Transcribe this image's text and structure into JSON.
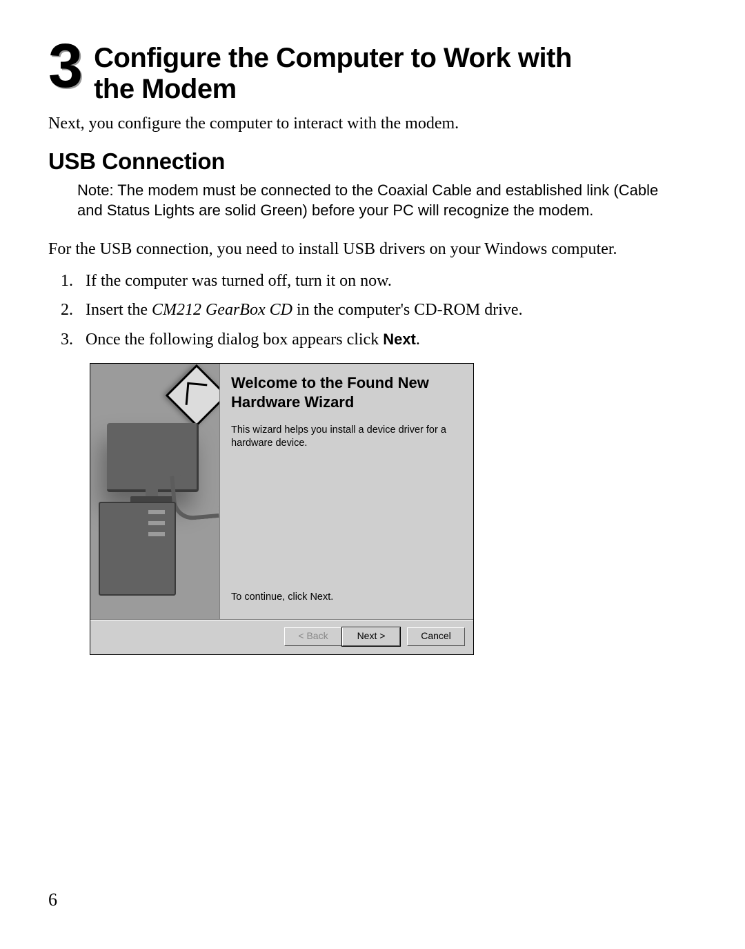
{
  "section_number": "3",
  "section_title_line1": "Configure the Computer to Work with",
  "section_title_line2": "the Modem",
  "intro": "Next, you configure the computer to interact with the modem.",
  "subheading": "USB Connection",
  "note": "Note: The modem must be connected to the Coaxial Cable and established link (Cable and Status Lights are solid Green) before your PC will recognize the modem.",
  "usb_para": "For the USB connection, you need to install USB drivers on your Windows computer.",
  "steps": {
    "s1": "If the computer was turned off, turn it on now.",
    "s2_prefix": "Insert the ",
    "s2_italic": "CM212 GearBox CD",
    "s2_suffix": " in the computer's CD-ROM drive.",
    "s3_prefix": "Once the following dialog box appears click ",
    "s3_bold": "Next",
    "s3_suffix": "."
  },
  "wizard": {
    "title_line1": "Welcome to the Found New",
    "title_line2": "Hardware Wizard",
    "body": "This wizard helps you install a device driver for a hardware device.",
    "continue": "To continue, click Next.",
    "buttons": {
      "back": "< Back",
      "next": "Next >",
      "cancel": "Cancel"
    }
  },
  "page_number": "6"
}
